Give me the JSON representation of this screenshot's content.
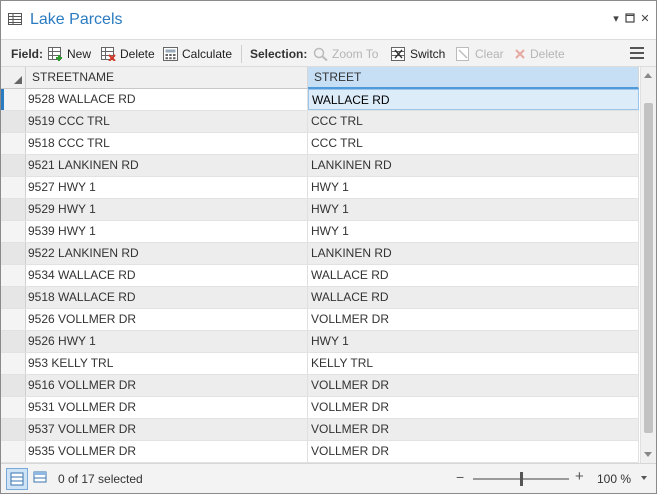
{
  "window": {
    "title": "Lake Parcels"
  },
  "toolbar": {
    "field_label": "Field:",
    "new_label": "New",
    "delete_field_label": "Delete",
    "calculate_label": "Calculate",
    "selection_label": "Selection:",
    "zoom_to_label": "Zoom To",
    "switch_label": "Switch",
    "clear_label": "Clear",
    "delete_sel_label": "Delete"
  },
  "table": {
    "columns": [
      "STREETNAME",
      "STREET"
    ],
    "rows": [
      [
        "9528 WALLACE RD",
        "WALLACE RD"
      ],
      [
        "9519 CCC TRL",
        "CCC TRL"
      ],
      [
        "9518 CCC TRL",
        "CCC TRL"
      ],
      [
        "9521 LANKINEN RD",
        "LANKINEN RD"
      ],
      [
        "9527 HWY 1",
        "HWY 1"
      ],
      [
        "9529 HWY 1",
        "HWY 1"
      ],
      [
        "9539 HWY 1",
        "HWY 1"
      ],
      [
        "9522 LANKINEN RD",
        "LANKINEN RD"
      ],
      [
        "9534 WALLACE RD",
        "WALLACE RD"
      ],
      [
        "9518 WALLACE RD",
        "WALLACE RD"
      ],
      [
        "9526 VOLLMER DR",
        "VOLLMER DR"
      ],
      [
        "9526 HWY 1",
        "HWY 1"
      ],
      [
        "953 KELLY TRL",
        "KELLY TRL"
      ],
      [
        "9516 VOLLMER DR",
        "VOLLMER DR"
      ],
      [
        "9531 VOLLMER DR",
        "VOLLMER DR"
      ],
      [
        "9537 VOLLMER DR",
        "VOLLMER DR"
      ],
      [
        "9535 VOLLMER DR",
        "VOLLMER DR"
      ]
    ]
  },
  "status": {
    "selection_text": "0 of 17 selected",
    "zoom": "100 %",
    "zoom_fraction": 0.5
  },
  "colors": {
    "accent": "#2b7bc0",
    "header_selected": "#c7dff5"
  },
  "icons": {
    "title": "table-icon",
    "new_field": "add-field-icon",
    "delete_field": "delete-field-icon",
    "calculate": "calculate-icon",
    "zoom_to": "zoom-to-icon",
    "switch": "switch-selection-icon",
    "clear": "clear-selection-icon",
    "delete_selection": "delete-x-icon",
    "menu": "hamburger-menu-icon"
  }
}
